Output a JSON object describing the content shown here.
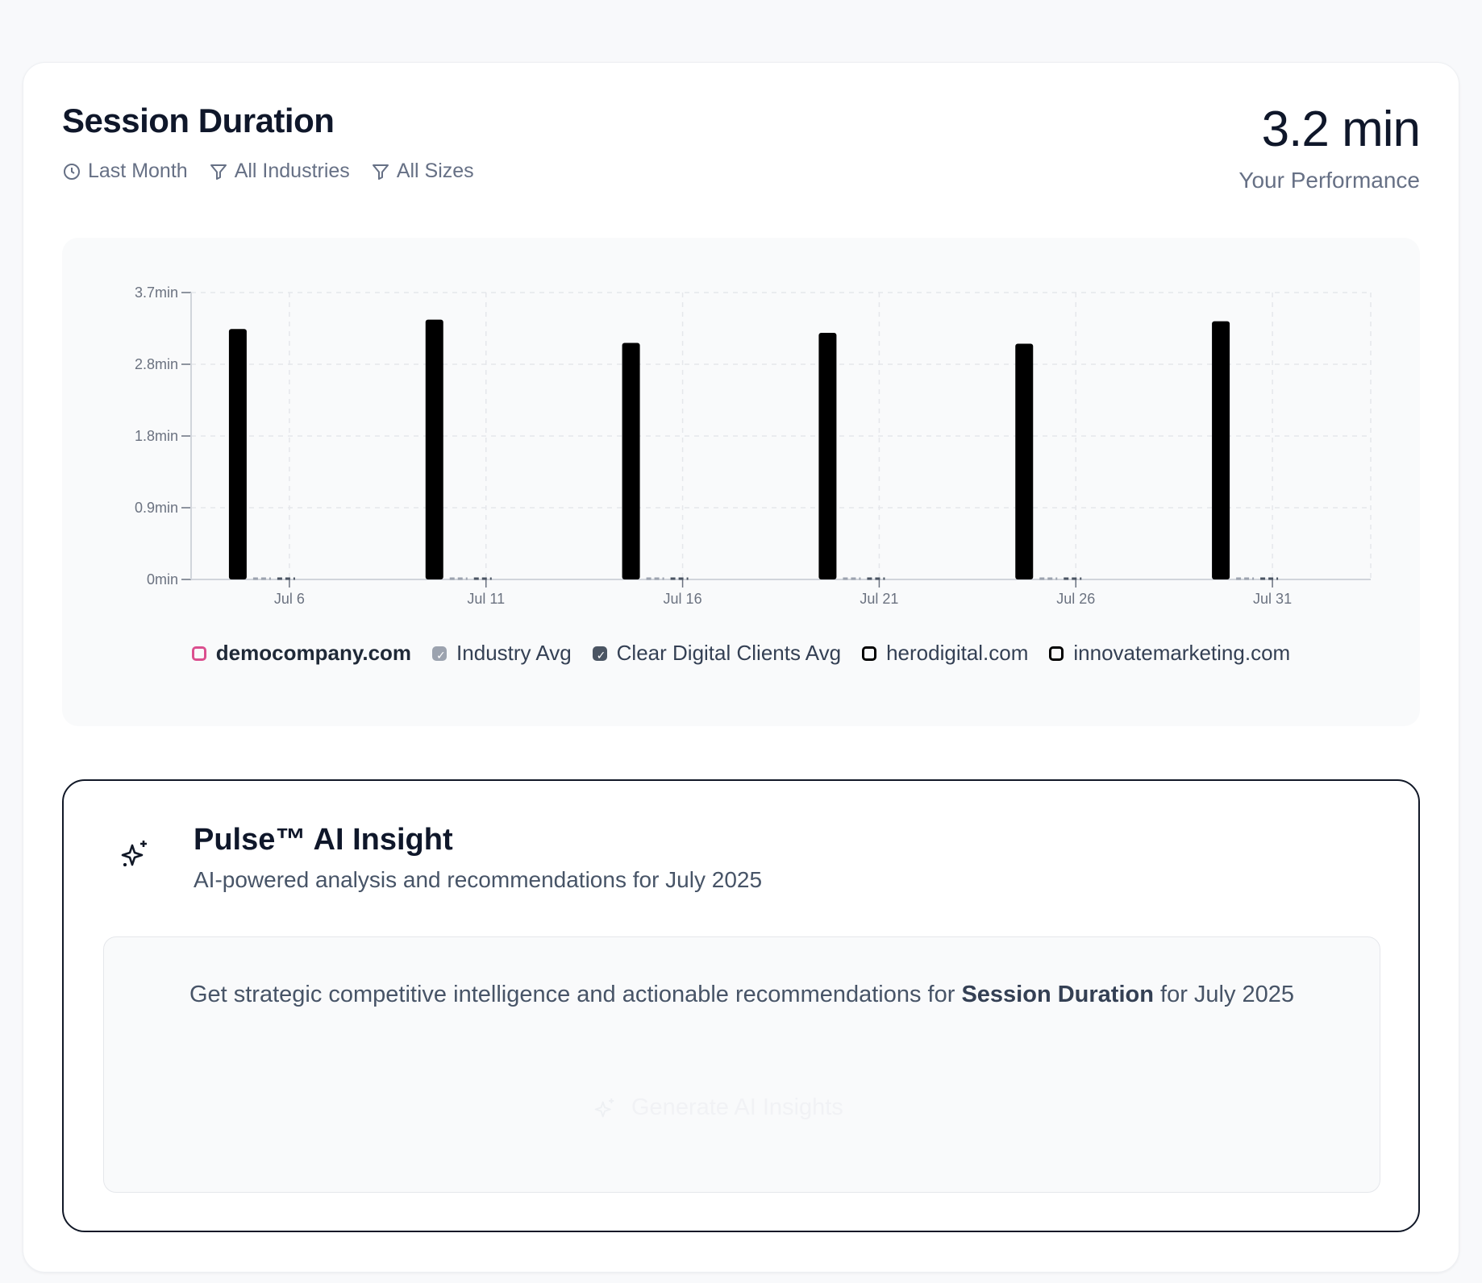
{
  "header": {
    "title": "Session Duration",
    "filters": [
      {
        "label": "Last Month",
        "icon": "clock-icon"
      },
      {
        "label": "All Industries",
        "icon": "filter-icon"
      },
      {
        "label": "All Sizes",
        "icon": "filter-icon"
      }
    ],
    "metric_value": "3.2 min",
    "metric_label": "Your Performance"
  },
  "chart_data": {
    "type": "bar",
    "categories": [
      "Jul 6",
      "Jul 11",
      "Jul 16",
      "Jul 21",
      "Jul 26",
      "Jul 31"
    ],
    "y_ticks": [
      "0min",
      "0.9min",
      "1.8min",
      "2.8min",
      "3.7min"
    ],
    "ylim": [
      0,
      3.7
    ],
    "grid": true,
    "series": [
      {
        "name": "democompany.com",
        "values": [
          3.23,
          3.35,
          3.05,
          3.18,
          3.04,
          3.33
        ],
        "color": "#000000"
      },
      {
        "name": "Industry Avg",
        "values": [
          0,
          0,
          0,
          0,
          0,
          0
        ],
        "color": "#9ca3af"
      },
      {
        "name": "Clear Digital Clients Avg",
        "values": [
          0,
          0,
          0,
          0,
          0,
          0
        ],
        "color": "#4b5563"
      }
    ],
    "legend_position": "bottom"
  },
  "legend": [
    {
      "label": "democompany.com",
      "color": "#db4f8f",
      "style": "pink",
      "checked": false,
      "active": true
    },
    {
      "label": "Industry Avg",
      "color": "#9ca3af",
      "style": "gray",
      "checked": true,
      "active": false
    },
    {
      "label": "Clear Digital Clients Avg",
      "color": "#4b5563",
      "style": "dark",
      "checked": true,
      "active": false
    },
    {
      "label": "herodigital.com",
      "color": "#000000",
      "style": "black",
      "checked": false,
      "active": false
    },
    {
      "label": "innovatemarketing.com",
      "color": "#000000",
      "style": "black",
      "checked": false,
      "active": false
    }
  ],
  "insight": {
    "title": "Pulse™ AI Insight",
    "subtitle": "AI-powered analysis and recommendations for July 2025",
    "body_prefix": "Get strategic competitive intelligence and actionable recommendations for ",
    "body_bold": "Session Duration",
    "body_suffix": " for July 2025",
    "button_label": "Generate AI Insights"
  }
}
